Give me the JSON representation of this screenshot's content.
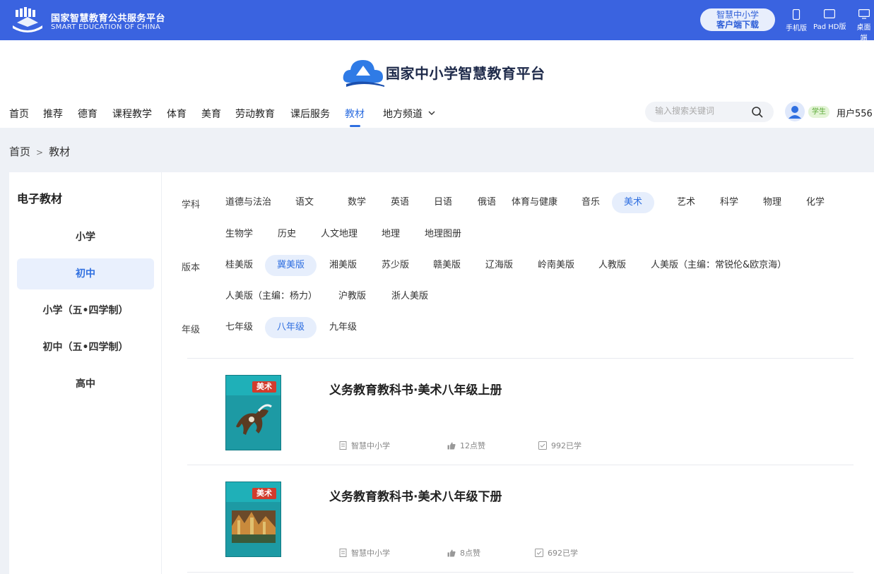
{
  "top_bar": {
    "title": "国家智慧教育公共服务平台",
    "subtitle": "SMART EDUCATION OF CHINA",
    "download_line1": "智慧中小学",
    "download_line2": "客户端下载",
    "devices": [
      {
        "label": "手机版",
        "icon": "phone-icon"
      },
      {
        "label": "Pad HD版",
        "icon": "tablet-icon"
      },
      {
        "label": "桌面端",
        "icon": "desktop-icon"
      }
    ]
  },
  "header": {
    "brand": "国家中小学智慧教育平台",
    "nav": [
      "首页",
      "推荐",
      "德育",
      "课程教学",
      "体育",
      "美育",
      "劳动教育",
      "课后服务",
      "教材",
      "地方频道"
    ],
    "active_nav": "教材",
    "search_placeholder": "输入搜索关键词",
    "role": "学生",
    "username": "用户556"
  },
  "breadcrumb": [
    "首页",
    "教材"
  ],
  "sidebar": {
    "title": "电子教材",
    "items": [
      "小学",
      "初中",
      "小学（五•四学制）",
      "初中（五•四学制）",
      "高中"
    ],
    "active": "初中"
  },
  "filters": {
    "subject_label": "学科",
    "subjects": [
      "道德与法治",
      "语文",
      "数学",
      "英语",
      "日语",
      "俄语",
      "体育与健康",
      "音乐",
      "美术",
      "艺术",
      "科学",
      "物理",
      "化学",
      "生物学",
      "历史",
      "人文地理",
      "地理",
      "地理图册"
    ],
    "subject_active": "美术",
    "edition_label": "版本",
    "editions": [
      "桂美版",
      "冀美版",
      "湘美版",
      "苏少版",
      "赣美版",
      "辽海版",
      "岭南美版",
      "人教版",
      "人美版（主编：常锐伦&欧京海）",
      "人美版（主编：杨力）",
      "沪教版",
      "浙人美版"
    ],
    "edition_active": "冀美版",
    "grade_label": "年级",
    "grades": [
      "七年级",
      "八年级",
      "九年级"
    ],
    "grade_active": "八年级"
  },
  "books": [
    {
      "title": "义务教育教科书·美术八年级上册",
      "publisher": "智慧中小学",
      "likes": "12点赞",
      "learners": "992已学",
      "cover_word": "美术"
    },
    {
      "title": "义务教育教科书·美术八年级下册",
      "publisher": "智慧中小学",
      "likes": "8点赞",
      "learners": "692已学",
      "cover_word": "美术"
    }
  ],
  "colors": {
    "brand_blue": "#3a63e0",
    "accent": "#2f6fe0",
    "active_bg": "#e6eefc"
  }
}
